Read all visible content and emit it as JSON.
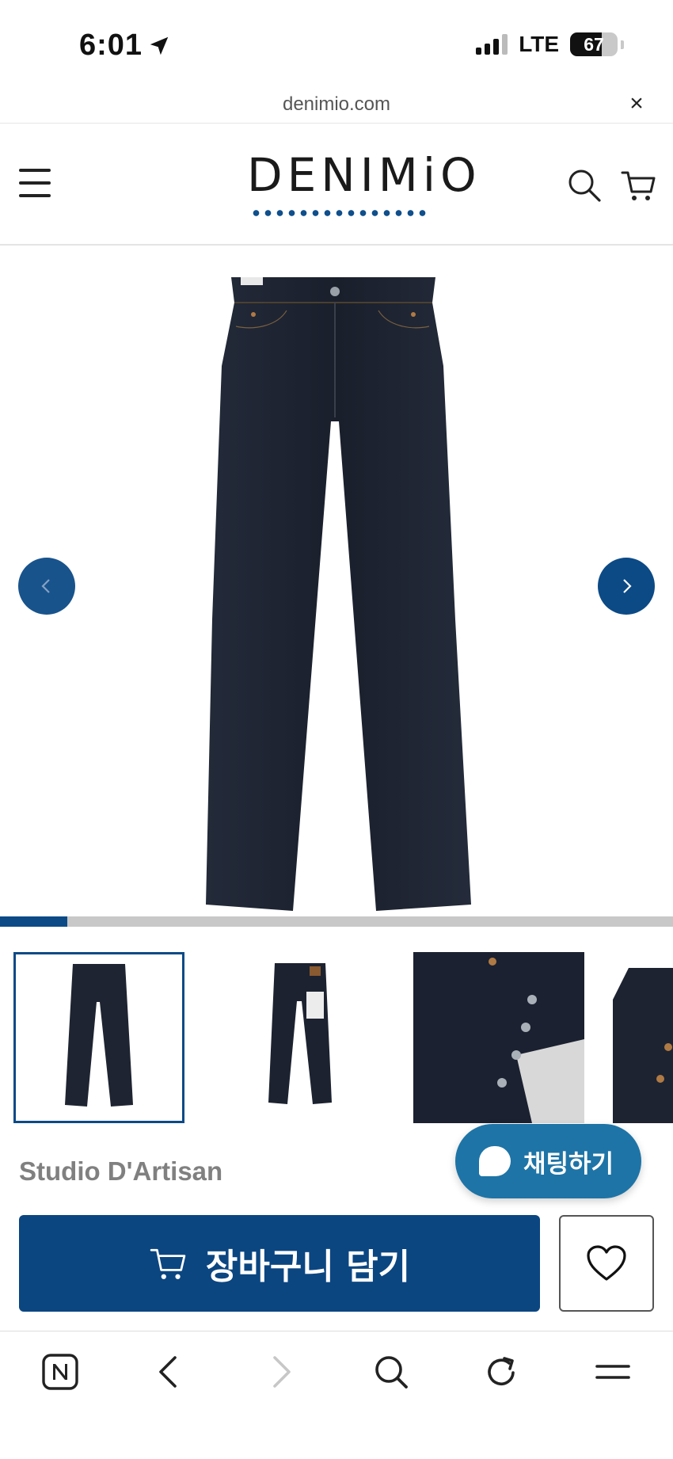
{
  "status_bar": {
    "time": "6:01",
    "network": "LTE",
    "battery": "67",
    "battery_level": 0.67
  },
  "browser": {
    "url": "denimio.com",
    "close_label": "×"
  },
  "header": {
    "logo_text": "DENIMiO"
  },
  "product": {
    "brand": "Studio D'Artisan",
    "image_index": 1,
    "image_count": 10,
    "progress_fraction": 0.1
  },
  "chat": {
    "label": "채팅하기"
  },
  "actions": {
    "add_to_cart_label": "장바구니 담기"
  },
  "colors": {
    "accent": "#0b4681",
    "chat": "#1e74a6",
    "denim": "#1c2230"
  },
  "icons": [
    "location-arrow-icon",
    "menu-icon",
    "search-icon",
    "cart-icon",
    "chevron-left-icon",
    "chevron-right-icon",
    "heart-icon",
    "naver-icon",
    "back-icon",
    "forward-icon",
    "refresh-icon"
  ]
}
